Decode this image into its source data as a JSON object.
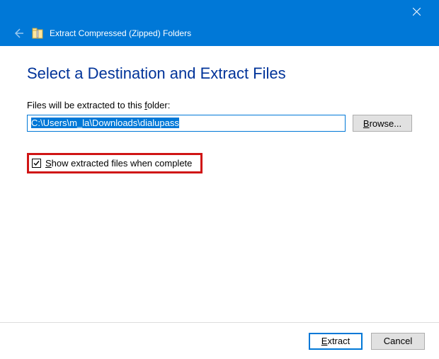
{
  "titlebar": {
    "wizard_title": "Extract Compressed (Zipped) Folders"
  },
  "content": {
    "heading": "Select a Destination and Extract Files",
    "folder_label_prefix": "Files will be extracted to this ",
    "folder_label_hotkey": "f",
    "folder_label_suffix": "older:",
    "path_value": "C:\\Users\\m_la\\Downloads\\dialupass",
    "browse_hotkey": "B",
    "browse_suffix": "rowse...",
    "checkbox_checked": true,
    "checkbox_hotkey": "S",
    "checkbox_suffix": "how extracted files when complete"
  },
  "footer": {
    "extract_hotkey": "E",
    "extract_suffix": "xtract",
    "cancel_label": "Cancel"
  }
}
